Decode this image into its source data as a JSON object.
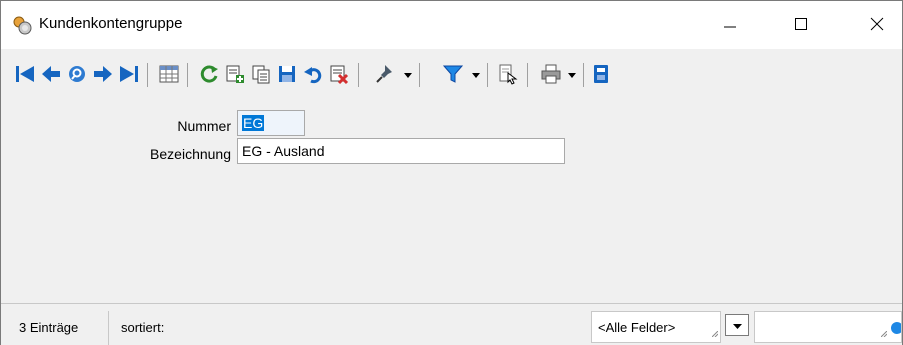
{
  "window": {
    "title": "Kundenkontengruppe",
    "controls": [
      "minimize",
      "maximize",
      "close"
    ]
  },
  "toolbar": {
    "buttons": [
      {
        "icon": "first-record-icon"
      },
      {
        "icon": "previous-record-icon"
      },
      {
        "icon": "search-icon"
      },
      {
        "icon": "next-record-icon"
      },
      {
        "icon": "last-record-icon"
      },
      {
        "icon": "table-view-icon"
      },
      {
        "icon": "refresh-icon"
      },
      {
        "icon": "new-record-icon"
      },
      {
        "icon": "copy-record-icon"
      },
      {
        "icon": "save-icon"
      },
      {
        "icon": "undo-icon"
      },
      {
        "icon": "delete-icon"
      },
      {
        "icon": "pin-icon"
      },
      {
        "icon": "filter-icon"
      },
      {
        "icon": "export-icon"
      },
      {
        "icon": "print-icon"
      },
      {
        "icon": "calculator-icon"
      }
    ],
    "colors": {
      "blue": "#1565c0",
      "green": "#2e8b2e",
      "red": "#d32f2f"
    }
  },
  "form": {
    "nummer_label": "Nummer",
    "nummer_value": "EG",
    "bezeichnung_label": "Bezeichnung",
    "bezeichnung_value": "EG - Ausland"
  },
  "statusbar": {
    "count": "3 Einträge",
    "sort": "sortiert:",
    "field_select": "<Alle Felder>",
    "search_value": ""
  }
}
